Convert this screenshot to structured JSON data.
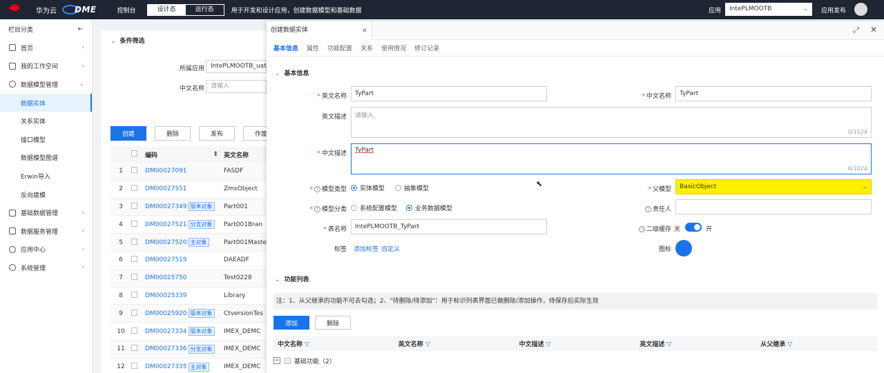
{
  "topbar": {
    "brand_text": "华为云",
    "product": "DME",
    "console": "控制台",
    "mode_design": "设计态",
    "mode_runtime": "运行态",
    "tagline": "用于开发和设计应用，创建数据模型和基础数据",
    "app_label": "应用",
    "app_value": "IntePLMOOTB",
    "publish": "应用发布"
  },
  "sidebar": {
    "header": "栏目分类",
    "items": [
      {
        "label": "首页",
        "icon": "home-icon"
      },
      {
        "label": "我的工作空间",
        "icon": "workspace-icon"
      },
      {
        "label": "数据模型管理",
        "icon": "model-icon"
      }
    ],
    "sub_items": [
      "数据实体",
      "关系实体",
      "接口模型",
      "数据模型图谱",
      "Erwin导入",
      "反向建模"
    ],
    "items_after": [
      {
        "label": "基础数据管理",
        "icon": "data-icon"
      },
      {
        "label": "数据服务管理",
        "icon": "service-icon"
      },
      {
        "label": "应用中心",
        "icon": "app-icon"
      },
      {
        "label": "系统管理",
        "icon": "settings-icon"
      }
    ]
  },
  "list": {
    "filter_title": "条件筛选",
    "app_label": "所属应用",
    "app_value": "IntePLMOOTB_uat",
    "cn_name_label": "中文名称",
    "cn_name_placeholder": "请输入",
    "buttons": [
      "创建",
      "删除",
      "发布",
      "作废"
    ],
    "columns": [
      "编码",
      "英文名称"
    ],
    "rows": [
      {
        "num": "1",
        "code": "DM00027091",
        "tag": "",
        "name": "FASDF"
      },
      {
        "num": "2",
        "code": "DM00027551",
        "tag": "",
        "name": "ZmsObject"
      },
      {
        "num": "3",
        "code": "DM00027349",
        "tag": "版本对象",
        "name": "Part001"
      },
      {
        "num": "4",
        "code": "DM00027521",
        "tag": "分支对象",
        "name": "Part001Bran"
      },
      {
        "num": "5",
        "code": "DM00027520",
        "tag": "主对象",
        "name": "Part001Maste"
      },
      {
        "num": "6",
        "code": "DM00027519",
        "tag": "",
        "name": "DAEADF"
      },
      {
        "num": "7",
        "code": "DM00025750",
        "tag": "",
        "name": "Test0228"
      },
      {
        "num": "8",
        "code": "DM00025339",
        "tag": "",
        "name": "Library"
      },
      {
        "num": "9",
        "code": "DM00025920",
        "tag": "版本对象",
        "name": "CtversionTes"
      },
      {
        "num": "10",
        "code": "DM00027334",
        "tag": "版本对象",
        "name": "IMEX_DEMC"
      },
      {
        "num": "11",
        "code": "DM00027336",
        "tag": "分支对象",
        "name": "IMEX_DEMC"
      },
      {
        "num": "12",
        "code": "DM00027335",
        "tag": "主对象",
        "name": "IMEX_DEMC"
      }
    ]
  },
  "drawer": {
    "tab_title": "创建数据实体",
    "subtabs": [
      "基本信息",
      "属性",
      "功能配置",
      "关系",
      "使用情况",
      "修订记录"
    ],
    "basic_title": "基本信息",
    "en_name_label": "英文名称",
    "en_name_value": "TyPart",
    "cn_name_label": "中文名称",
    "cn_name_value": "TyPart",
    "en_desc_label": "英文描述",
    "en_desc_placeholder": "请输入",
    "en_desc_count": "0/1024",
    "cn_desc_label": "中文描述",
    "cn_desc_value": "TyPart",
    "cn_desc_count": "6/1024",
    "model_type_label": "模型类型",
    "model_type_opt1": "实体模型",
    "model_type_opt2": "抽象模型",
    "parent_label": "父模型",
    "parent_value": "BasicObject",
    "model_class_label": "模型分类",
    "model_class_opt1": "系统配置模型",
    "model_class_opt2": "业务数据模型",
    "owner_label": "责任人",
    "table_label": "表名称",
    "table_value": "IntePLMOOTB_TyPart",
    "cache_label": "二级缓存",
    "cache_off": "关",
    "cache_on": "开",
    "tag_label": "标签",
    "add_tag": "添加标签",
    "custom": "自定义",
    "icon_label": "图标",
    "func_title": "功能列表",
    "note": "注：1、从父继承的功能不可去勾选；2、\"待删除/待添加\"：用于标识列表界面已做删除/添加操作，待保存后实际生效",
    "add_btn": "添加",
    "del_btn": "删除",
    "func_columns": [
      "中文名称",
      "英文名称",
      "中文描述",
      "英文描述",
      "从父继承"
    ],
    "group_label": "基础功能（2）"
  }
}
